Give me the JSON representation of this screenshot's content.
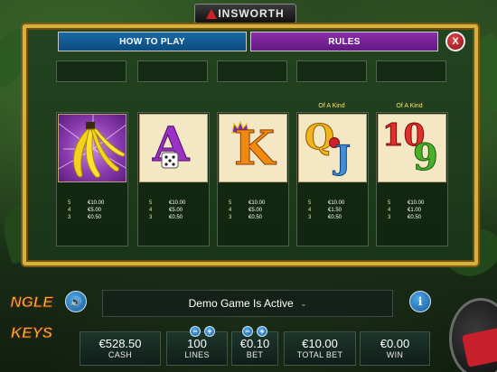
{
  "brand": {
    "name": "INSWORTH"
  },
  "tabs": {
    "how_to_play": "HOW TO PLAY",
    "rules": "RULES",
    "active": "rules"
  },
  "close": {
    "glyph": "X"
  },
  "symbols": [
    {
      "name": "banana",
      "ofkind": "",
      "pays": [
        {
          "count": "5",
          "value": "€10.00"
        },
        {
          "count": "4",
          "value": "€5.00"
        },
        {
          "count": "3",
          "value": "€0.50"
        }
      ]
    },
    {
      "name": "A",
      "ofkind": "",
      "pays": [
        {
          "count": "5",
          "value": "€10.00"
        },
        {
          "count": "4",
          "value": "€5.00"
        },
        {
          "count": "3",
          "value": "€0.50"
        }
      ]
    },
    {
      "name": "K",
      "ofkind": "",
      "pays": [
        {
          "count": "5",
          "value": "€10.00"
        },
        {
          "count": "4",
          "value": "€5.00"
        },
        {
          "count": "3",
          "value": "€0.50"
        }
      ]
    },
    {
      "name": "QJ",
      "ofkind": "Of A Kind",
      "pays": [
        {
          "count": "5",
          "value": "€10.00"
        },
        {
          "count": "4",
          "value": "€1.50"
        },
        {
          "count": "3",
          "value": "€0.50"
        }
      ]
    },
    {
      "name": "109",
      "ofkind": "Of A Kind",
      "pays": [
        {
          "count": "5",
          "value": "€10.00"
        },
        {
          "count": "4",
          "value": "€1.00"
        },
        {
          "count": "3",
          "value": "€0.50"
        }
      ]
    }
  ],
  "card_letters": {
    "a": "A",
    "k": "K",
    "q": "Q",
    "j": "J",
    "ten": "10",
    "nine": "9"
  },
  "game_logo": {
    "line1": "NGLE",
    "line2": "KEYS"
  },
  "status": {
    "message": "Demo Game Is Active",
    "chevron": "⌄"
  },
  "hud": {
    "cash": {
      "value": "€528.50",
      "label": "CASH"
    },
    "lines": {
      "value": "100",
      "label": "LINES"
    },
    "bet": {
      "value": "€0.10",
      "label": "BET"
    },
    "total_bet": {
      "value": "€10.00",
      "label": "TOTAL BET"
    },
    "win": {
      "value": "€0.00",
      "label": "WIN"
    }
  },
  "controls": {
    "minus": "−",
    "plus": "+",
    "info": "i",
    "sound": "🔊"
  },
  "colors": {
    "gold_frame": "#d8b13a",
    "tab_blue": "#1a6aa6",
    "tab_purple": "#8a2ea8",
    "pay_yellow": "#f5e27a"
  }
}
